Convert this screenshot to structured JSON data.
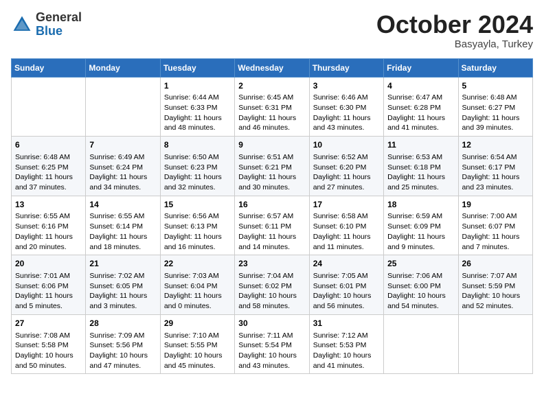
{
  "header": {
    "logo_general": "General",
    "logo_blue": "Blue",
    "month_title": "October 2024",
    "subtitle": "Basyayla, Turkey"
  },
  "days_of_week": [
    "Sunday",
    "Monday",
    "Tuesday",
    "Wednesday",
    "Thursday",
    "Friday",
    "Saturday"
  ],
  "weeks": [
    [
      {
        "day": "",
        "sunrise": "",
        "sunset": "",
        "daylight": ""
      },
      {
        "day": "",
        "sunrise": "",
        "sunset": "",
        "daylight": ""
      },
      {
        "day": "1",
        "sunrise": "Sunrise: 6:44 AM",
        "sunset": "Sunset: 6:33 PM",
        "daylight": "Daylight: 11 hours and 48 minutes."
      },
      {
        "day": "2",
        "sunrise": "Sunrise: 6:45 AM",
        "sunset": "Sunset: 6:31 PM",
        "daylight": "Daylight: 11 hours and 46 minutes."
      },
      {
        "day": "3",
        "sunrise": "Sunrise: 6:46 AM",
        "sunset": "Sunset: 6:30 PM",
        "daylight": "Daylight: 11 hours and 43 minutes."
      },
      {
        "day": "4",
        "sunrise": "Sunrise: 6:47 AM",
        "sunset": "Sunset: 6:28 PM",
        "daylight": "Daylight: 11 hours and 41 minutes."
      },
      {
        "day": "5",
        "sunrise": "Sunrise: 6:48 AM",
        "sunset": "Sunset: 6:27 PM",
        "daylight": "Daylight: 11 hours and 39 minutes."
      }
    ],
    [
      {
        "day": "6",
        "sunrise": "Sunrise: 6:48 AM",
        "sunset": "Sunset: 6:25 PM",
        "daylight": "Daylight: 11 hours and 37 minutes."
      },
      {
        "day": "7",
        "sunrise": "Sunrise: 6:49 AM",
        "sunset": "Sunset: 6:24 PM",
        "daylight": "Daylight: 11 hours and 34 minutes."
      },
      {
        "day": "8",
        "sunrise": "Sunrise: 6:50 AM",
        "sunset": "Sunset: 6:23 PM",
        "daylight": "Daylight: 11 hours and 32 minutes."
      },
      {
        "day": "9",
        "sunrise": "Sunrise: 6:51 AM",
        "sunset": "Sunset: 6:21 PM",
        "daylight": "Daylight: 11 hours and 30 minutes."
      },
      {
        "day": "10",
        "sunrise": "Sunrise: 6:52 AM",
        "sunset": "Sunset: 6:20 PM",
        "daylight": "Daylight: 11 hours and 27 minutes."
      },
      {
        "day": "11",
        "sunrise": "Sunrise: 6:53 AM",
        "sunset": "Sunset: 6:18 PM",
        "daylight": "Daylight: 11 hours and 25 minutes."
      },
      {
        "day": "12",
        "sunrise": "Sunrise: 6:54 AM",
        "sunset": "Sunset: 6:17 PM",
        "daylight": "Daylight: 11 hours and 23 minutes."
      }
    ],
    [
      {
        "day": "13",
        "sunrise": "Sunrise: 6:55 AM",
        "sunset": "Sunset: 6:16 PM",
        "daylight": "Daylight: 11 hours and 20 minutes."
      },
      {
        "day": "14",
        "sunrise": "Sunrise: 6:55 AM",
        "sunset": "Sunset: 6:14 PM",
        "daylight": "Daylight: 11 hours and 18 minutes."
      },
      {
        "day": "15",
        "sunrise": "Sunrise: 6:56 AM",
        "sunset": "Sunset: 6:13 PM",
        "daylight": "Daylight: 11 hours and 16 minutes."
      },
      {
        "day": "16",
        "sunrise": "Sunrise: 6:57 AM",
        "sunset": "Sunset: 6:11 PM",
        "daylight": "Daylight: 11 hours and 14 minutes."
      },
      {
        "day": "17",
        "sunrise": "Sunrise: 6:58 AM",
        "sunset": "Sunset: 6:10 PM",
        "daylight": "Daylight: 11 hours and 11 minutes."
      },
      {
        "day": "18",
        "sunrise": "Sunrise: 6:59 AM",
        "sunset": "Sunset: 6:09 PM",
        "daylight": "Daylight: 11 hours and 9 minutes."
      },
      {
        "day": "19",
        "sunrise": "Sunrise: 7:00 AM",
        "sunset": "Sunset: 6:07 PM",
        "daylight": "Daylight: 11 hours and 7 minutes."
      }
    ],
    [
      {
        "day": "20",
        "sunrise": "Sunrise: 7:01 AM",
        "sunset": "Sunset: 6:06 PM",
        "daylight": "Daylight: 11 hours and 5 minutes."
      },
      {
        "day": "21",
        "sunrise": "Sunrise: 7:02 AM",
        "sunset": "Sunset: 6:05 PM",
        "daylight": "Daylight: 11 hours and 3 minutes."
      },
      {
        "day": "22",
        "sunrise": "Sunrise: 7:03 AM",
        "sunset": "Sunset: 6:04 PM",
        "daylight": "Daylight: 11 hours and 0 minutes."
      },
      {
        "day": "23",
        "sunrise": "Sunrise: 7:04 AM",
        "sunset": "Sunset: 6:02 PM",
        "daylight": "Daylight: 10 hours and 58 minutes."
      },
      {
        "day": "24",
        "sunrise": "Sunrise: 7:05 AM",
        "sunset": "Sunset: 6:01 PM",
        "daylight": "Daylight: 10 hours and 56 minutes."
      },
      {
        "day": "25",
        "sunrise": "Sunrise: 7:06 AM",
        "sunset": "Sunset: 6:00 PM",
        "daylight": "Daylight: 10 hours and 54 minutes."
      },
      {
        "day": "26",
        "sunrise": "Sunrise: 7:07 AM",
        "sunset": "Sunset: 5:59 PM",
        "daylight": "Daylight: 10 hours and 52 minutes."
      }
    ],
    [
      {
        "day": "27",
        "sunrise": "Sunrise: 7:08 AM",
        "sunset": "Sunset: 5:58 PM",
        "daylight": "Daylight: 10 hours and 50 minutes."
      },
      {
        "day": "28",
        "sunrise": "Sunrise: 7:09 AM",
        "sunset": "Sunset: 5:56 PM",
        "daylight": "Daylight: 10 hours and 47 minutes."
      },
      {
        "day": "29",
        "sunrise": "Sunrise: 7:10 AM",
        "sunset": "Sunset: 5:55 PM",
        "daylight": "Daylight: 10 hours and 45 minutes."
      },
      {
        "day": "30",
        "sunrise": "Sunrise: 7:11 AM",
        "sunset": "Sunset: 5:54 PM",
        "daylight": "Daylight: 10 hours and 43 minutes."
      },
      {
        "day": "31",
        "sunrise": "Sunrise: 7:12 AM",
        "sunset": "Sunset: 5:53 PM",
        "daylight": "Daylight: 10 hours and 41 minutes."
      },
      {
        "day": "",
        "sunrise": "",
        "sunset": "",
        "daylight": ""
      },
      {
        "day": "",
        "sunrise": "",
        "sunset": "",
        "daylight": ""
      }
    ]
  ]
}
